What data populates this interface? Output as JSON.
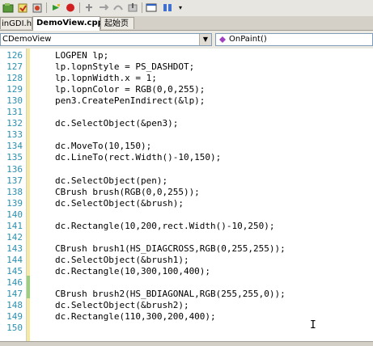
{
  "toolbar": {
    "icons": [
      "project-icon",
      "build-icon",
      "compile-icon",
      "run-icon",
      "stop-icon",
      "breakpoint-icon",
      "step-icon",
      "step-over-icon",
      "step-out-icon",
      "debug-window-icon",
      "overflow-chevron-icon"
    ]
  },
  "tabs": [
    {
      "label": "inGDI.h"
    },
    {
      "label": "DemoView.cpp*"
    },
    {
      "label": "起始页"
    }
  ],
  "combo": {
    "class_value": "CDemoView",
    "member_value": "OnPaint()"
  },
  "editor": {
    "lines": [
      {
        "n": "126",
        "code": "LOGPEN lp;"
      },
      {
        "n": "127",
        "code": "lp.lopnStyle = PS_DASHDOT;"
      },
      {
        "n": "128",
        "code": "lp.lopnWidth.x = 1;"
      },
      {
        "n": "129",
        "code": "lp.lopnColor = RGB(0,0,255);"
      },
      {
        "n": "130",
        "code": "pen3.CreatePenIndirect(&lp);"
      },
      {
        "n": "131",
        "code": ""
      },
      {
        "n": "132",
        "code": "dc.SelectObject(&pen3);"
      },
      {
        "n": "133",
        "code": ""
      },
      {
        "n": "134",
        "code": "dc.MoveTo(10,150);"
      },
      {
        "n": "135",
        "code": "dc.LineTo(rect.Width()-10,150);"
      },
      {
        "n": "136",
        "code": ""
      },
      {
        "n": "137",
        "code": "dc.SelectObject(pen);"
      },
      {
        "n": "138",
        "code": "CBrush brush(RGB(0,0,255));"
      },
      {
        "n": "139",
        "code": "dc.SelectObject(&brush);"
      },
      {
        "n": "140",
        "code": ""
      },
      {
        "n": "141",
        "code": "dc.Rectangle(10,200,rect.Width()-10,250);"
      },
      {
        "n": "142",
        "code": ""
      },
      {
        "n": "143",
        "code": "CBrush brush1(HS_DIAGCROSS,RGB(0,255,255));"
      },
      {
        "n": "144",
        "code": "dc.SelectObject(&brush1);"
      },
      {
        "n": "145",
        "code": "dc.Rectangle(10,300,100,400);"
      },
      {
        "n": "146",
        "code": ""
      },
      {
        "n": "147",
        "code": "CBrush brush2(HS_BDIAGONAL,RGB(255,255,0));"
      },
      {
        "n": "148",
        "code": "dc.SelectObject(&brush2);"
      },
      {
        "n": "149",
        "code": "dc.Rectangle(110,300,200,400);"
      },
      {
        "n": "150",
        "code": ""
      }
    ]
  },
  "colors": {
    "line_number": "#2b91af",
    "modified_bar": "#f5e9a0",
    "saved_bar": "#9ccf7a"
  }
}
